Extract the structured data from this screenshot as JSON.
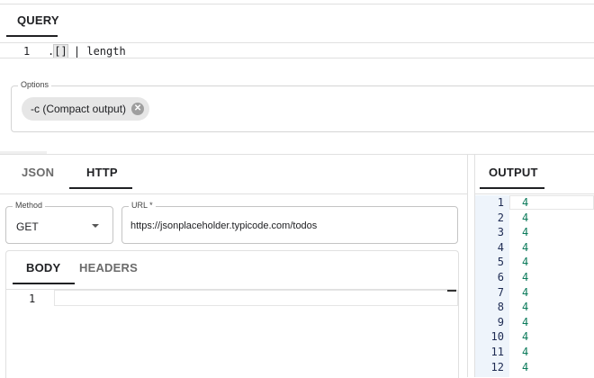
{
  "query": {
    "tab_label": "QUERY",
    "line_number": "1",
    "code_prefix": ".",
    "code_bracket": "[]",
    "code_rest": " | length"
  },
  "options": {
    "legend": "Options",
    "chip_label": "-c (Compact output)"
  },
  "input_tabs": {
    "json": "JSON",
    "http": "HTTP"
  },
  "http": {
    "method_label": "Method",
    "method_value": "GET",
    "url_label": "URL *",
    "url_value": "https://jsonplaceholder.typicode.com/todos",
    "tabs": {
      "body": "BODY",
      "headers": "HEADERS"
    },
    "body_line": "1"
  },
  "output": {
    "tab_label": "OUTPUT",
    "lines": [
      {
        "n": "1",
        "v": "4"
      },
      {
        "n": "2",
        "v": "4"
      },
      {
        "n": "3",
        "v": "4"
      },
      {
        "n": "4",
        "v": "4"
      },
      {
        "n": "5",
        "v": "4"
      },
      {
        "n": "6",
        "v": "4"
      },
      {
        "n": "7",
        "v": "4"
      },
      {
        "n": "8",
        "v": "4"
      },
      {
        "n": "9",
        "v": "4"
      },
      {
        "n": "10",
        "v": "4"
      },
      {
        "n": "11",
        "v": "4"
      },
      {
        "n": "12",
        "v": "4"
      }
    ]
  },
  "colors": {
    "output_value": "#0b7a5a",
    "output_linenum": "#1d2a52",
    "active_tab_underline": "#202124"
  }
}
